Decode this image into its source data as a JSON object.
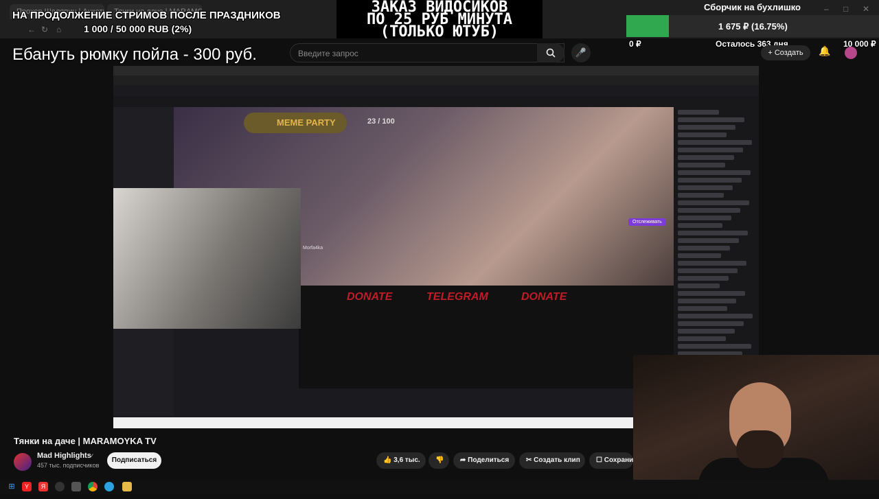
{
  "browser": {
    "tabs": [
      "Прохор Шаляпин | Анкеты",
      "Тянки на даче | MARAMO"
    ],
    "window_controls": [
      "–",
      "□",
      "✕"
    ]
  },
  "goal_overlay": {
    "title": "НА ПРОДОЛЖЕНИЕ СТРИМОВ ПОСЛЕ ПРАЗДНИКОВ",
    "progress": "1 000 / 50 000 RUB (2%)"
  },
  "order_banner": {
    "lines": [
      "ЗАКАЗ ВИДОСИКОВ",
      "ПО 25 РУБ МИНУТА",
      "(ТОЛЬКО ЮТУБ)"
    ]
  },
  "fundraiser": {
    "title": "Сборчик на бухлишко",
    "value": "1 675 ₽ (16.75%)",
    "fraction": 0.1675,
    "min": "0 ₽",
    "remaining": "Осталось 363 дня",
    "max": "10 000 ₽",
    "fill_color": "#2fa84f"
  },
  "donation_text": "Ебануть рюмку пойла - 300 руб.",
  "youtube_header": {
    "search_placeholder": "Введите запрос",
    "create_label": "Создать",
    "search_icon": "search-icon",
    "mic_icon": "mic-icon",
    "bell_icon": "bell-icon"
  },
  "video_content": {
    "meme_party": "MEME PARTY",
    "meme_count": "23 / 100",
    "panels": [
      "DONATE",
      "TELEGRAM",
      "DONATE"
    ],
    "follow_label": "Отслеживать",
    "streamer_name": "Morfa4ka"
  },
  "video": {
    "title": "Тянки на даче | MARAMOYKA TV"
  },
  "channel": {
    "name": "Mad Highlights",
    "verified": "✓",
    "subscribers": "457 тыс. подписчиков",
    "subscribe_label": "Подписаться"
  },
  "actions": {
    "like_count": "3,6 тыс.",
    "share_label": "Поделиться",
    "clip_label": "Создать клип",
    "save_label": "Сохрани"
  },
  "taskbar": {
    "icons": [
      "windows-icon",
      "yandex-icon",
      "yandex-browser-icon",
      "obs-icon",
      "chrome-icon",
      "telegram-icon",
      "explorer-icon"
    ]
  }
}
